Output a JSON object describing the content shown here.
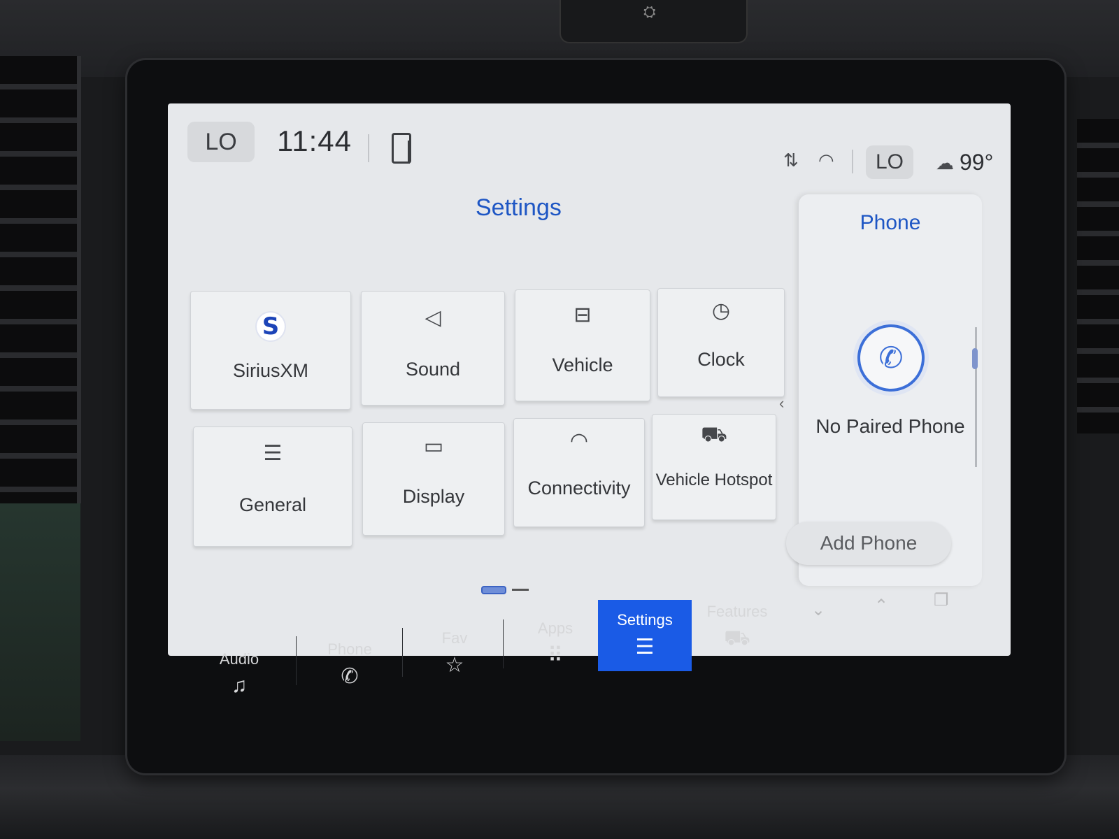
{
  "status_bar": {
    "climate_left": "LO",
    "time": "11:44",
    "climate_right": "LO",
    "outside_temp": "99°",
    "icons": [
      "phone-projection-icon",
      "signal-icon",
      "wifi-icon",
      "temperature-icon"
    ]
  },
  "settings": {
    "title": "Settings",
    "tiles": [
      {
        "label": "SiriusXM",
        "icon": "siriusxm-icon",
        "glyph": "S"
      },
      {
        "label": "Sound",
        "icon": "speaker-icon",
        "glyph": "◁"
      },
      {
        "label": "Vehicle",
        "icon": "vehicle-settings-icon",
        "glyph": "⊟"
      },
      {
        "label": "Clock",
        "icon": "clock-icon",
        "glyph": "◷"
      },
      {
        "label": "General",
        "icon": "sliders-icon",
        "glyph": "☰"
      },
      {
        "label": "Display",
        "icon": "display-icon",
        "glyph": "▭"
      },
      {
        "label": "Connectivity",
        "icon": "wifi-icon",
        "glyph": "◠"
      },
      {
        "label": "Vehicle Hotspot",
        "icon": "hotspot-truck-icon",
        "glyph": "⛟"
      }
    ],
    "page_indicator": {
      "current": 1,
      "total": 2
    }
  },
  "phone_panel": {
    "title": "Phone",
    "status": "No Paired Phone",
    "add_button": "Add Phone",
    "call_glyph": "✆"
  },
  "nav": {
    "items": [
      {
        "label": "Audio",
        "glyph": "♫"
      },
      {
        "label": "Phone",
        "glyph": "✆"
      },
      {
        "label": "Fav",
        "glyph": "☆"
      },
      {
        "label": "Apps",
        "glyph": "⠿"
      },
      {
        "label": "Settings",
        "glyph": "☰",
        "active": true
      },
      {
        "label": "Features",
        "glyph": "⛟"
      }
    ],
    "collapse_glyph": "⌄",
    "expand_glyph": "⌃",
    "recent_glyph": "❐"
  },
  "colors": {
    "accent": "#1e56c4",
    "nav_active": "#1a5be6",
    "screen_bg": "#e6e8eb"
  }
}
